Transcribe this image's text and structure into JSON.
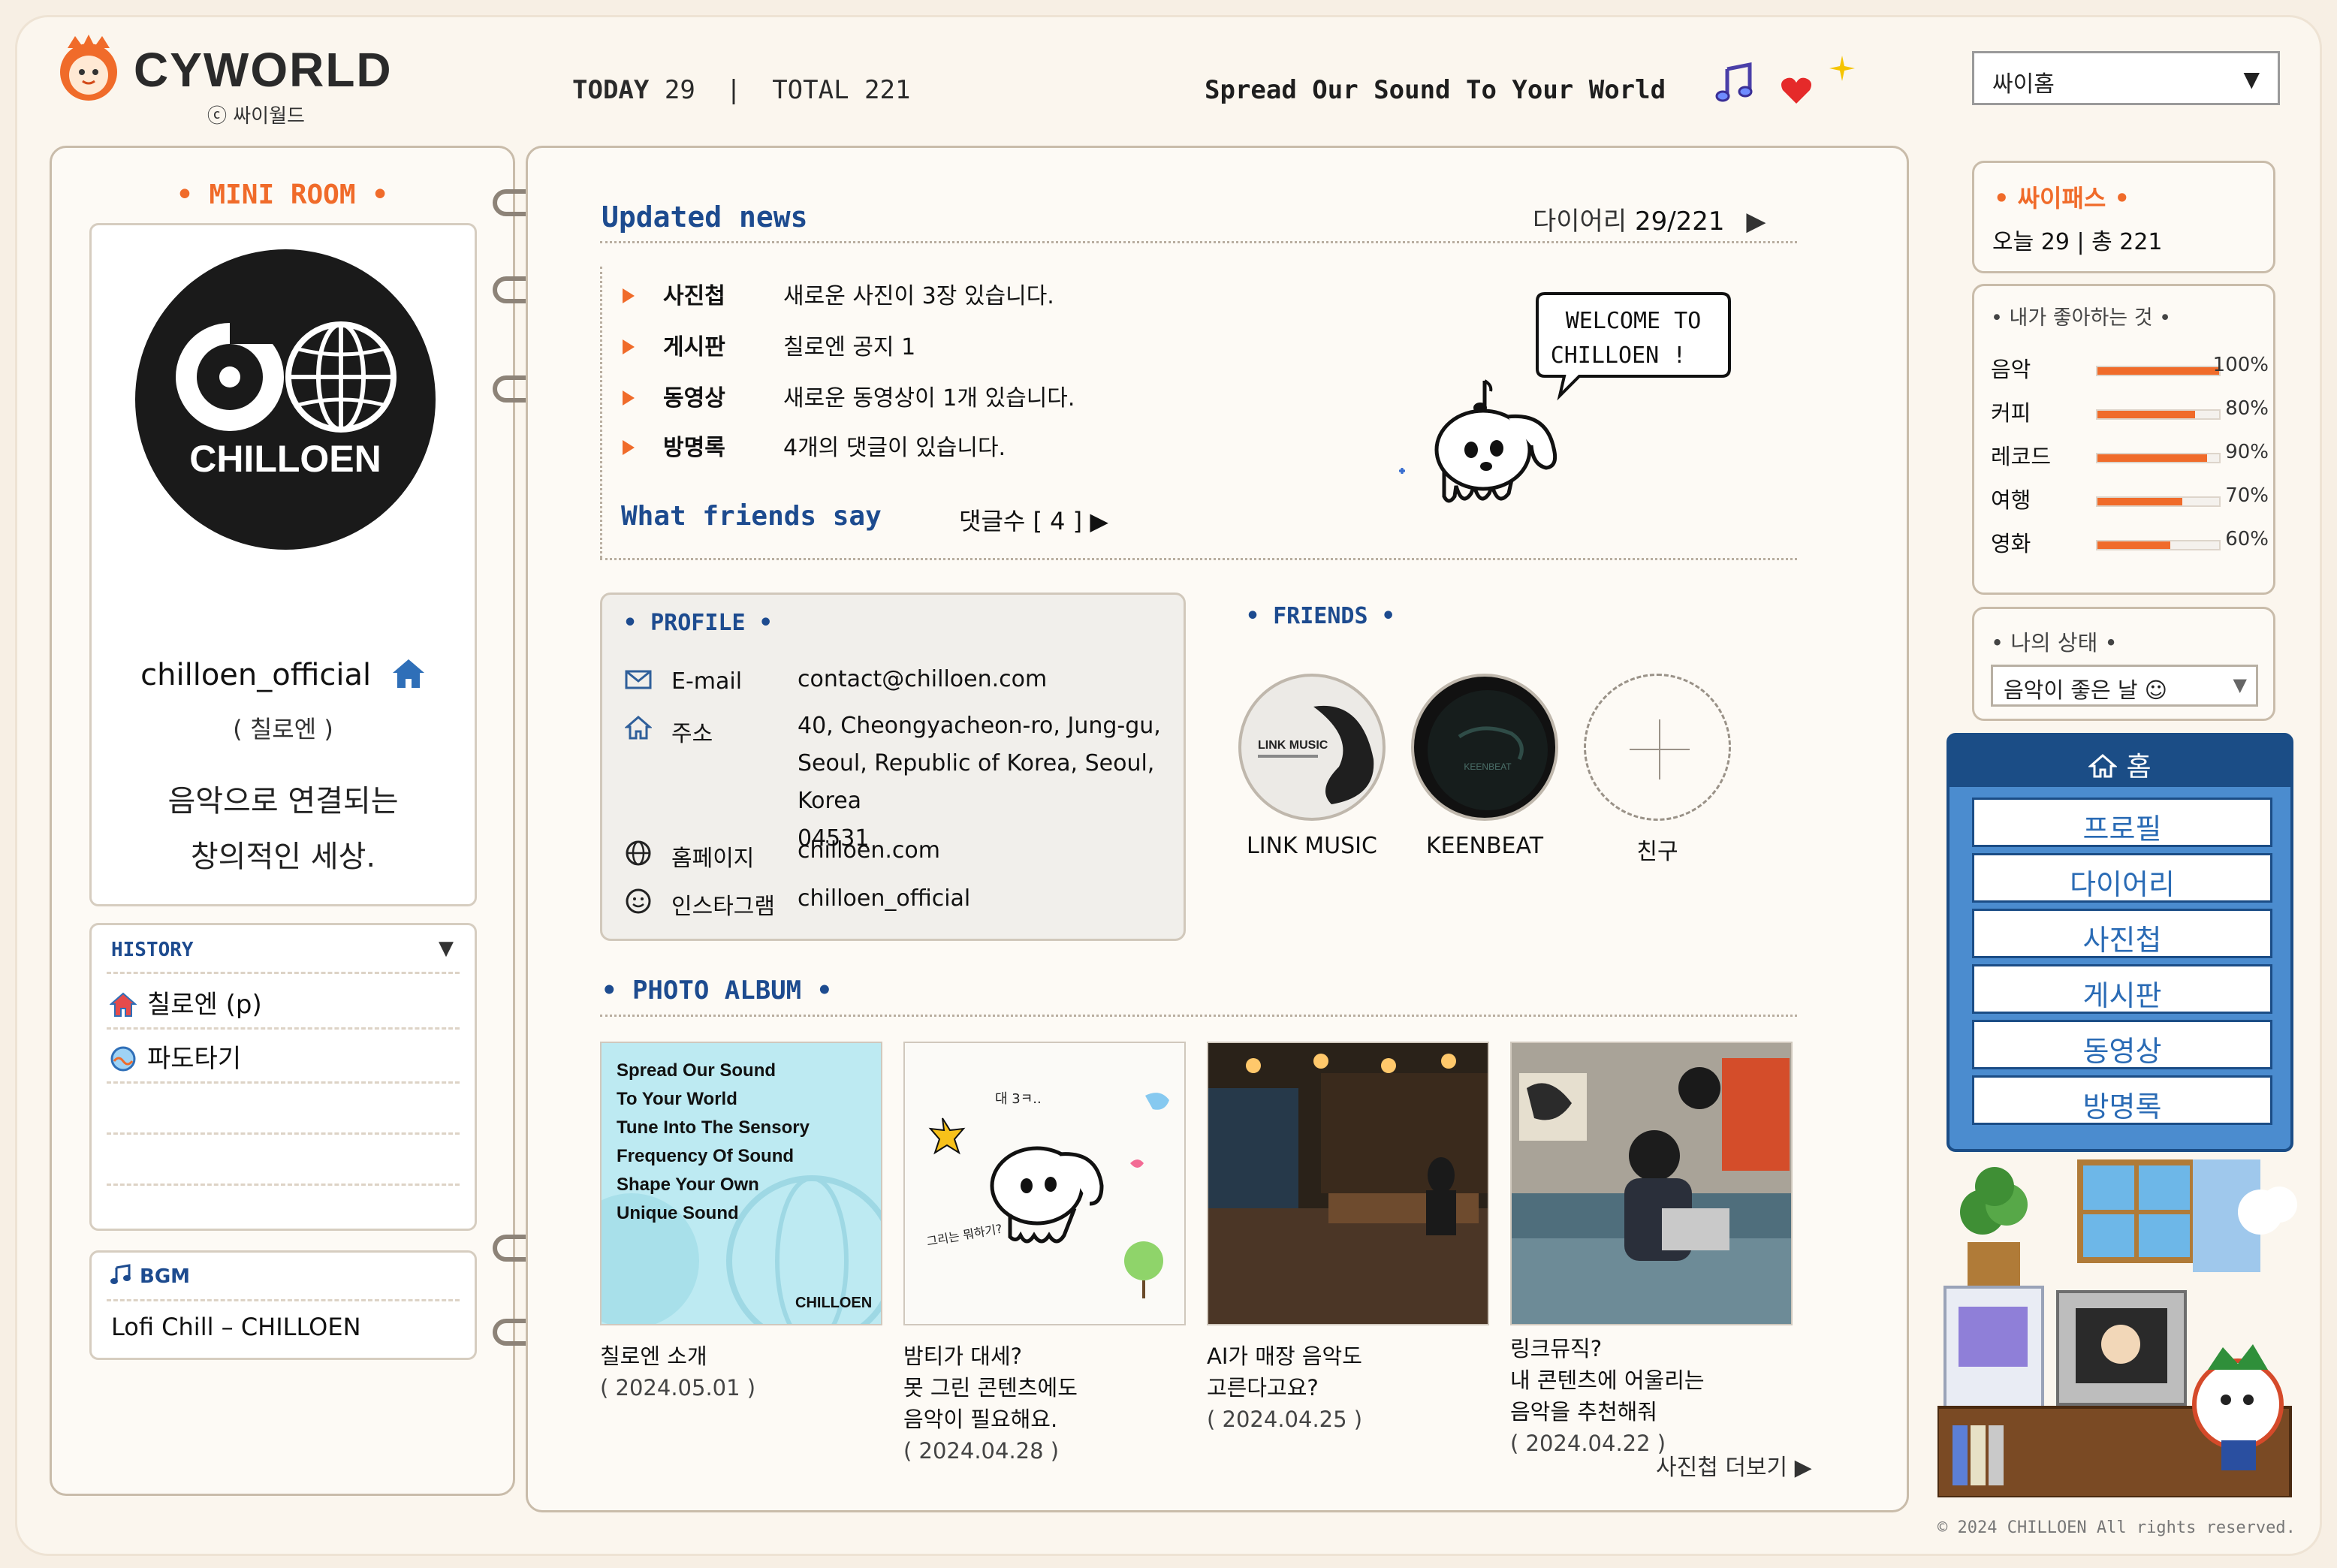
{
  "header": {
    "brand": "CYWORLD",
    "brand_sub": "ⓒ 싸이월드",
    "today_label": "TODAY",
    "today_value": "29",
    "total_label": "TOTAL",
    "total_value": "221",
    "slogan": "Spread Our Sound To Your World",
    "site_select": "싸이홈"
  },
  "left": {
    "mini_room_title": "• MINI ROOM •",
    "logo_text": "CHILLOEN",
    "username": "chilloen_official",
    "realname": "( 칠로엔 )",
    "motto_line1": "음악으로 연결되는",
    "motto_line2": "창의적인 세상.",
    "history_title": "HISTORY",
    "history_items": [
      "칠로엔 (p)",
      "파도타기"
    ],
    "bgm_title": "BGM",
    "bgm_track": "Lofi Chill – CHILLOEN"
  },
  "news": {
    "title": "Updated news",
    "diary_label": "다이어리",
    "diary_count": "29/221",
    "rows": [
      {
        "cat": "사진첩",
        "text": "새로운 사진이 3장 있습니다."
      },
      {
        "cat": "게시판",
        "text": "칠로엔 공지 1"
      },
      {
        "cat": "동영상",
        "text": "새로운 동영상이 1개 있습니다."
      },
      {
        "cat": "방명록",
        "text": "4개의 댓글이 있습니다."
      }
    ],
    "friends_say": "What friends say",
    "comment_count": "댓글수 [ 4 ] ▶",
    "welcome_line1": "WELCOME TO",
    "welcome_line2": "CHILLOEN !"
  },
  "profile": {
    "title": "• PROFILE •",
    "email_label": "E-mail",
    "email": "contact@chilloen.com",
    "address_label": "주소",
    "address_line1": "40, Cheongyacheon-ro, Jung-gu,",
    "address_line2": "Seoul, Republic of Korea, Seoul, Korea",
    "address_line3": "04531",
    "homepage_label": "홈페이지",
    "homepage": "chilloen.com",
    "instagram_label": "인스타그램",
    "instagram": "chilloen_official"
  },
  "friends": {
    "title": "• FRIENDS •",
    "items": [
      "LINK MUSIC",
      "KEENBEAT",
      "친구"
    ],
    "linkmusic_logo": "LINK MUSIC",
    "keenbeat_logo": "KEENBEAT"
  },
  "album": {
    "title": "• PHOTO ALBUM •",
    "photo1_text": [
      "Spread Our Sound",
      "To Your World",
      "Tune Into The Sensory",
      "Frequency Of Sound",
      "Shape Your Own",
      "Unique Sound"
    ],
    "photo1_brand": "CHILLOEN",
    "photo2_doodle1": "대 3ㅋ..",
    "photo2_doodle2": "그리는 뭐하기?",
    "items": [
      {
        "lines": [
          "칠로엔 소개"
        ],
        "date": "( 2024.05.01 )"
      },
      {
        "lines": [
          "밤티가 대세?",
          "못 그린 콘텐츠에도",
          "음악이 필요해요."
        ],
        "date": "( 2024.04.28 )"
      },
      {
        "lines": [
          "AI가 매장 음악도",
          "고른다고요?"
        ],
        "date": "( 2024.04.25 )"
      },
      {
        "lines": [
          "링크뮤직?",
          "내 콘텐츠에 어울리는",
          "음악을 추천해줘"
        ],
        "date": "( 2024.04.22 )"
      }
    ],
    "more": "사진첩 더보기 ▶"
  },
  "right": {
    "cypass_title": "• 싸이패스 •",
    "cypass_count": "오늘  29  |  총  221",
    "likes_title": "• 내가 좋아하는 것 •",
    "likes": [
      {
        "name": "음악",
        "pct": "100%",
        "value": 100
      },
      {
        "name": "커피",
        "pct": "80%",
        "value": 80
      },
      {
        "name": "레코드",
        "pct": "90%",
        "value": 90
      },
      {
        "name": "여행",
        "pct": "70%",
        "value": 70
      },
      {
        "name": "영화",
        "pct": "60%",
        "value": 60
      }
    ],
    "mood_title": "• 나의 상태 •",
    "mood_value": "음악이 좋은 날 ☺",
    "nav_home": "홈",
    "nav_items": [
      "프로필",
      "다이어리",
      "사진첩",
      "게시판",
      "동영상",
      "방명록"
    ]
  },
  "footer": {
    "copyright": "© 2024 CHILLOEN All rights reserved."
  },
  "colors": {
    "accent": "#f06b2a",
    "title_blue": "#1d4b8f",
    "nav_blue": "#4b8ccf",
    "background": "#f7efe4"
  }
}
